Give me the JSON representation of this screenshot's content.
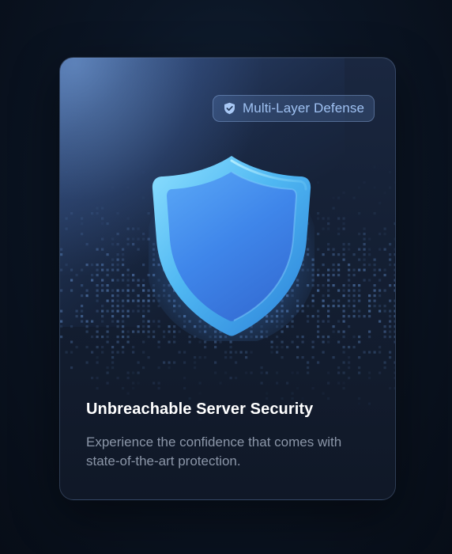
{
  "card": {
    "badge": {
      "icon": "shield-check-icon",
      "label": "Multi-Layer Defense"
    },
    "illustration": {
      "icon": "shield-icon"
    },
    "title": "Unbreachable Server Security",
    "subtitle": "Experience the confidence that comes with state-of-the-art protection."
  },
  "colors": {
    "background": "#0b1524",
    "card": "#141f33",
    "accent": "#5a9bf0",
    "badge_text": "#9fc1f2",
    "title": "#ffffff",
    "subtitle": "#8b96a8"
  }
}
